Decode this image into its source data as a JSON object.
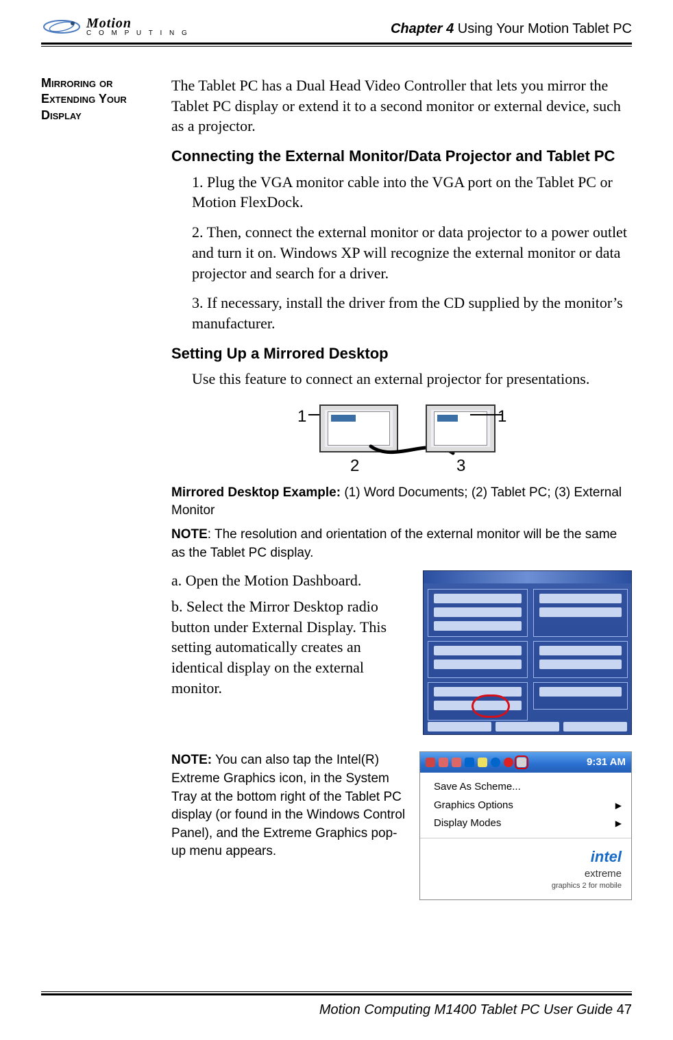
{
  "header": {
    "logo_brand": "Motion",
    "logo_sub": "C O M P U T I N G",
    "chapter_prefix": "Chapter 4",
    "chapter_title": " Using Your Motion Tablet PC"
  },
  "sidebar": {
    "heading": "Mirroring or Extending Your Display"
  },
  "body": {
    "intro": "The Tablet PC has a Dual Head Video Controller that lets you mirror the Tablet PC display or extend it to a second monitor or external device, such as a projector.",
    "h_connect": "Connecting the External Monitor/Data Projector and Tablet PC",
    "steps": {
      "s1": "1. Plug the VGA monitor cable into the VGA port on the Tablet PC or Motion FlexDock.",
      "s2": "2. Then, connect the external monitor or data projector to a power outlet and turn it on. Windows XP will recognize the external monitor or data projector and search for a driver.",
      "s3": "3. If necessary, install the driver from the CD supplied by the monitor’s manufacturer."
    },
    "h_mirror": "Setting Up a Mirrored Desktop",
    "mirror_intro": "Use this feature to connect an external projector for presentations.",
    "diagram_labels": {
      "one_a": "1",
      "one_b": "1",
      "two": "2",
      "three": "3"
    },
    "caption_bold": "Mirrored Desktop Example:",
    "caption_rest": " (1) Word Documents; (2) Tablet PC; (3) External Monitor",
    "note1_bold": "NOTE",
    "note1_rest": ": The resolution and orientation of the external monitor will be the same as the Tablet PC display.",
    "step_a": "a. Open the Motion Dashboard.",
    "step_b": "b. Select the Mirror Desktop radio button under External Display. This setting automatically creates an identical display on the external monitor.",
    "note2_bold": "NOTE:",
    "note2_rest": " You can also tap the Intel(R) Extreme Graphics icon, in the System Tray at the bottom right of the Tablet PC display (or found in the Windows Control Panel), and the Extreme Graphics pop-up menu appears."
  },
  "tray": {
    "time": "9:31 AM",
    "menu": {
      "m1": "Save As Scheme...",
      "m2": "Graphics Options",
      "m3": "Display Modes"
    },
    "intel_line1": "intel",
    "intel_line2": "extreme",
    "intel_line3": "graphics 2 for mobile"
  },
  "footer": {
    "text": "Motion Computing M1400 Tablet PC User Guide ",
    "page": "47"
  }
}
